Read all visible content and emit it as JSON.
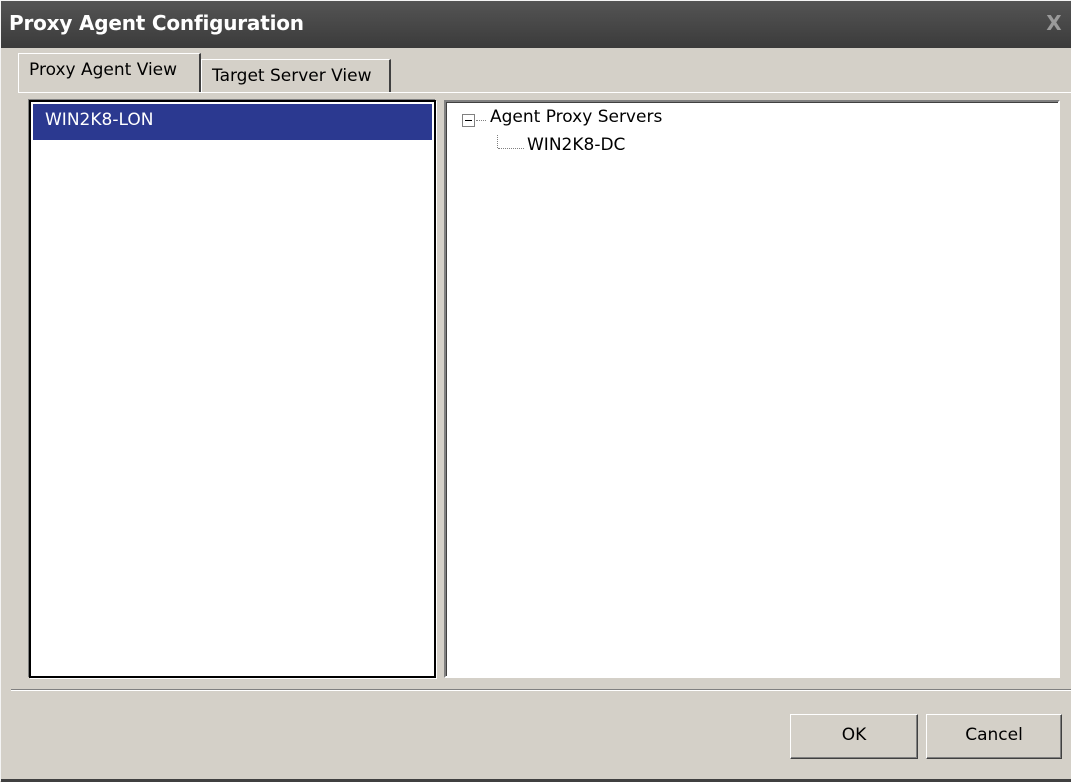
{
  "window": {
    "title": "Proxy Agent Configuration",
    "close_glyph": "X"
  },
  "tabs": [
    {
      "label": "Proxy Agent View",
      "selected": true
    },
    {
      "label": "Target Server View",
      "selected": false
    }
  ],
  "agent_list": {
    "items": [
      {
        "label": "WIN2K8-LON",
        "selected": true
      }
    ]
  },
  "proxy_tree": {
    "root": {
      "label": "Agent Proxy Servers",
      "expanded": true
    },
    "children": [
      {
        "label": "WIN2K8-DC"
      }
    ]
  },
  "buttons": {
    "ok_label": "OK",
    "cancel_label": "Cancel"
  },
  "colors": {
    "titlebar": "#3b3b3b",
    "selection": "#2b3990",
    "dialog_face": "#d4d0c8"
  },
  "icons": [
    "close-icon",
    "tree-collapse-icon"
  ]
}
